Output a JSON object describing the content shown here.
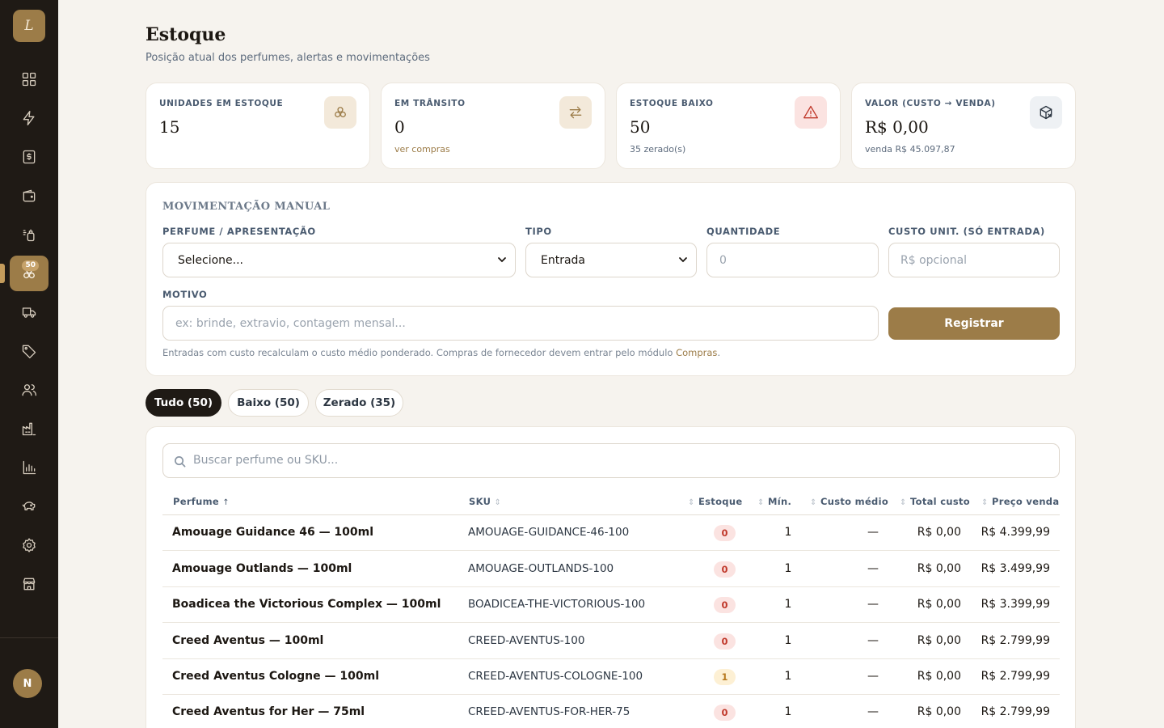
{
  "sidebar": {
    "logo_letter": "L",
    "active_badge": "50",
    "avatar_initial": "N",
    "items": [
      {
        "icon": "dashboard-icon"
      },
      {
        "icon": "lightning-icon"
      },
      {
        "icon": "receipt-dollar-icon"
      },
      {
        "icon": "wallet-icon"
      },
      {
        "icon": "perfume-bottle-icon"
      },
      {
        "icon": "stock-boxes-icon"
      },
      {
        "icon": "truck-icon"
      },
      {
        "icon": "tag-icon"
      },
      {
        "icon": "users-icon"
      },
      {
        "icon": "factory-icon"
      },
      {
        "icon": "bar-chart-icon"
      },
      {
        "icon": "piggy-bank-icon"
      },
      {
        "icon": "settings-icon"
      },
      {
        "icon": "store-icon"
      }
    ]
  },
  "header": {
    "title": "Estoque",
    "subtitle": "Posição atual dos perfumes, alertas e movimentações"
  },
  "kpis": [
    {
      "label": "UNIDADES EM ESTOQUE",
      "value": "15",
      "sub": "",
      "icon": "boxes-icon",
      "accent": "#f3e9da",
      "icon_color": "#9c7c48"
    },
    {
      "label": "EM TRÂNSITO",
      "value": "0",
      "sub": "ver compras",
      "icon": "transfer-arrows-icon",
      "accent": "#f3e9da",
      "icon_color": "#9c7c48"
    },
    {
      "label": "ESTOQUE BAIXO",
      "value": "50",
      "sub": "35 zerado(s)",
      "icon": "alert-triangle-icon",
      "accent": "#fbe3e1",
      "icon_color": "#c0392b"
    },
    {
      "label": "VALOR (CUSTO → VENDA)",
      "value": "R$ 0,00",
      "sub": "venda R$ 45.097,87",
      "icon": "package-x-icon",
      "accent": "#eef1f4",
      "icon_color": "#2c3642"
    }
  ],
  "form": {
    "title": "MOVIMENTAÇÃO MANUAL",
    "perfume_label": "PERFUME / APRESENTAÇÃO",
    "perfume_value": "Selecione...",
    "tipo_label": "TIPO",
    "tipo_value": "Entrada",
    "quantidade_label": "QUANTIDADE",
    "quantidade_placeholder": "0",
    "custo_label": "CUSTO UNIT. (SÓ ENTRADA)",
    "custo_placeholder": "R$ opcional",
    "motivo_label": "MOTIVO",
    "motivo_placeholder": "ex: brinde, extravio, contagem mensal...",
    "register_label": "Registrar",
    "hint_text": "Entradas com custo recalculam o custo médio ponderado. Compras de fornecedor devem entrar pelo módulo ",
    "hint_link": "Compras",
    "hint_end": "."
  },
  "filters": [
    {
      "label": "Tudo (50)",
      "active": true
    },
    {
      "label": "Baixo (50)",
      "active": false
    },
    {
      "label": "Zerado (35)",
      "active": false
    }
  ],
  "table": {
    "search_placeholder": "Buscar perfume ou SKU...",
    "columns": {
      "perfume": "Perfume",
      "sku": "SKU",
      "estoque": "Estoque",
      "min": "Mín.",
      "custo_medio": "Custo médio",
      "total_custo": "Total custo",
      "preco_venda": "Preço venda"
    },
    "rows": [
      {
        "name": "Amouage Guidance 46 — 100ml",
        "sku": "AMOUAGE-GUIDANCE-46-100",
        "stock": "0",
        "status": "zero",
        "min": "1",
        "avg": "—",
        "total": "R$ 0,00",
        "price": "R$ 4.399,99"
      },
      {
        "name": "Amouage Outlands — 100ml",
        "sku": "AMOUAGE-OUTLANDS-100",
        "stock": "0",
        "status": "zero",
        "min": "1",
        "avg": "—",
        "total": "R$ 0,00",
        "price": "R$ 3.499,99"
      },
      {
        "name": "Boadicea the Victorious Complex — 100ml",
        "sku": "BOADICEA-THE-VICTORIOUS-100",
        "stock": "0",
        "status": "zero",
        "min": "1",
        "avg": "—",
        "total": "R$ 0,00",
        "price": "R$ 3.399,99"
      },
      {
        "name": "Creed Aventus — 100ml",
        "sku": "CREED-AVENTUS-100",
        "stock": "0",
        "status": "zero",
        "min": "1",
        "avg": "—",
        "total": "R$ 0,00",
        "price": "R$ 2.799,99"
      },
      {
        "name": "Creed Aventus Cologne — 100ml",
        "sku": "CREED-AVENTUS-COLOGNE-100",
        "stock": "1",
        "status": "low",
        "min": "1",
        "avg": "—",
        "total": "R$ 0,00",
        "price": "R$ 2.799,99"
      },
      {
        "name": "Creed Aventus for Her — 75ml",
        "sku": "CREED-AVENTUS-FOR-HER-75",
        "stock": "0",
        "status": "zero",
        "min": "1",
        "avg": "—",
        "total": "R$ 0,00",
        "price": "R$ 2.799,99"
      }
    ]
  }
}
